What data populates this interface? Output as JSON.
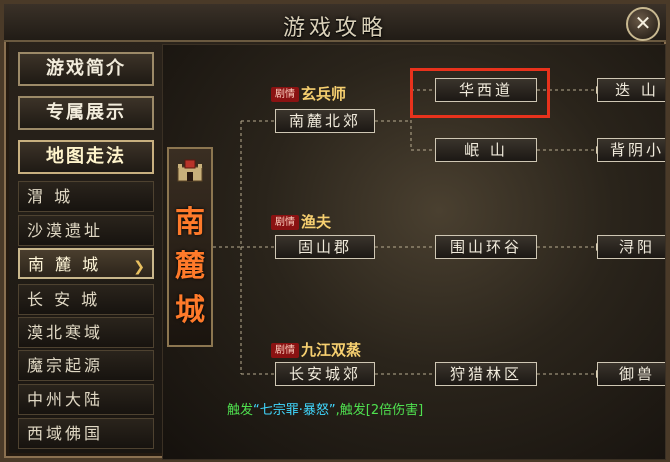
{
  "window": {
    "title": "游戏攻略",
    "close_glyph": "✕"
  },
  "sidebar": {
    "categories": [
      {
        "label": "游戏简介"
      },
      {
        "label": "专属展示"
      },
      {
        "label": "地图走法"
      }
    ],
    "maps": [
      {
        "label": "渭 城"
      },
      {
        "label": "沙漠遗址"
      },
      {
        "label": "南 麓 城"
      },
      {
        "label": "长 安 城"
      },
      {
        "label": "漠北寒域"
      },
      {
        "label": "魔宗起源"
      },
      {
        "label": "中州大陆"
      },
      {
        "label": "西域佛国"
      }
    ],
    "selected_arrow": "❯"
  },
  "city": {
    "name": "南麓城"
  },
  "routes": [
    {
      "plot_tag": "剧情",
      "plot_name": "玄兵师",
      "start": "南麓北郊",
      "branch_a": [
        "华西道",
        "迭 山"
      ],
      "branch_b": [
        "岷 山",
        "背阴小"
      ]
    },
    {
      "plot_tag": "剧情",
      "plot_name": "渔夫",
      "nodes": [
        "固山郡",
        "围山环谷",
        "浔阳"
      ]
    },
    {
      "plot_tag": "剧情",
      "plot_name": "九江双蒸",
      "nodes": [
        "长安城郊",
        "狩猎林区",
        "御兽"
      ]
    }
  ],
  "trigger": {
    "prefix": "触发",
    "skill": "“七宗罪·暴怒”",
    "middle": ",触发",
    "effect": "[2倍伤害]"
  },
  "colors": {
    "highlight": "#e8321c",
    "city_name": "#ff7a2a",
    "plot_name": "#f7d070"
  }
}
